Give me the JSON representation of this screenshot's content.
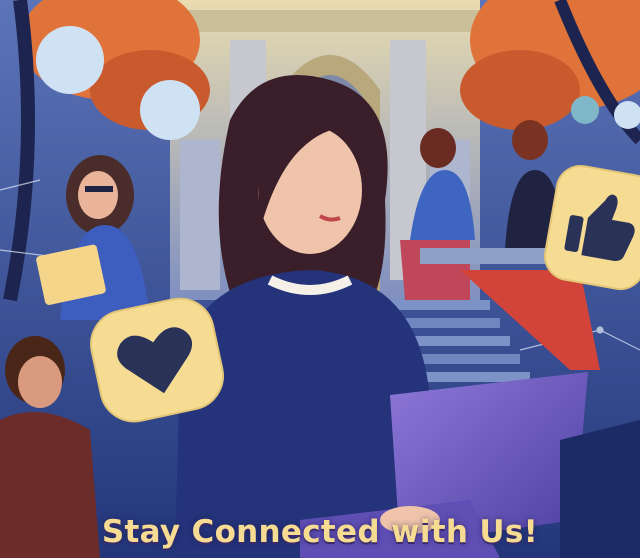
{
  "caption": "Stay Connected with Us!",
  "badges": [
    {
      "icon": "heart-icon",
      "color": "#f6dc93"
    },
    {
      "icon": "thumbs-up-icon",
      "color": "#f6dc93"
    }
  ],
  "colors": {
    "background": "#2a3f86",
    "building": "#d9cfa6",
    "foliage": "#e0733a",
    "badge": "#f6dc93",
    "caption": "#f6dc93"
  }
}
